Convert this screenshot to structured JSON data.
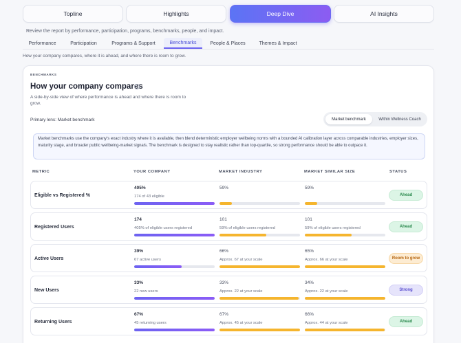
{
  "top_tabs": [
    "Topline",
    "Highlights",
    "Deep Dive",
    "AI Insights"
  ],
  "top_tabs_active": "Deep Dive",
  "review_text": "Review the report by performance, participation, programs, benchmarks, people, and impact.",
  "sub_tabs": [
    "Performance",
    "Participation",
    "Programs & Support",
    "Benchmarks",
    "People & Places",
    "Themes & Impact"
  ],
  "sub_tabs_active": "Benchmarks",
  "section_description": "How your company compares, where it is ahead, and where there is room to grow.",
  "card": {
    "eyebrow": "BENCHMARKS",
    "title": "How your company compares",
    "info_glyph": "i",
    "subtitle": "A side-by-side view of where performance is ahead and where there is room to grow.",
    "lens_label": "Primary lens: Market benchmark",
    "toggle": {
      "options": [
        "Market benchmark",
        "Within Wellness Coach"
      ],
      "active": "Market benchmark"
    },
    "note": "Market benchmarks use the company's exact industry where it is available, then blend deterministic employer wellbeing norms with a bounded AI calibration layer across comparable industries, employer sizes, maturity stage, and broader public wellbeing-market signals. The benchmark is designed to stay realistic rather than top-quartile, so strong performance should be able to outpace it.",
    "columns": [
      "METRIC",
      "YOUR COMPANY",
      "MARKET INDUSTRY",
      "MARKET SIMILAR SIZE",
      "STATUS"
    ],
    "rows": [
      {
        "metric": "Eligible vs Registered %",
        "company": {
          "value": "405%",
          "sub": "174 of 43 eligible",
          "fill": 1.0
        },
        "industry": {
          "value": "59%",
          "sub": "",
          "fill": 0.15
        },
        "similar": {
          "value": "59%",
          "sub": "",
          "fill": 0.15
        },
        "status": "Ahead",
        "status_kind": "ahead"
      },
      {
        "metric": "Registered Users",
        "company": {
          "value": "174",
          "sub": "405% of eligible users registered",
          "fill": 1.0
        },
        "industry": {
          "value": "101",
          "sub": "59% of eligible users registered",
          "fill": 0.58
        },
        "similar": {
          "value": "101",
          "sub": "59% of eligible users registered",
          "fill": 0.58
        },
        "status": "Ahead",
        "status_kind": "ahead"
      },
      {
        "metric": "Active Users",
        "company": {
          "value": "39%",
          "sub": "67 active users",
          "fill": 0.59
        },
        "industry": {
          "value": "66%",
          "sub": "Approx. 67 at your scale",
          "fill": 1.0
        },
        "similar": {
          "value": "65%",
          "sub": "Approx. 66 at your scale",
          "fill": 1.0
        },
        "status": "Room to grow",
        "status_kind": "grow"
      },
      {
        "metric": "New Users",
        "company": {
          "value": "33%",
          "sub": "22 new users",
          "fill": 1.0
        },
        "industry": {
          "value": "33%",
          "sub": "Approx. 22 at your scale",
          "fill": 0.98
        },
        "similar": {
          "value": "34%",
          "sub": "Approx. 22 at your scale",
          "fill": 1.0
        },
        "status": "Strong",
        "status_kind": "strong"
      },
      {
        "metric": "Returning Users",
        "company": {
          "value": "67%",
          "sub": "45 returning users",
          "fill": 1.0
        },
        "industry": {
          "value": "67%",
          "sub": "Approx. 45 at your scale",
          "fill": 1.0
        },
        "similar": {
          "value": "66%",
          "sub": "Approx. 44 at your scale",
          "fill": 0.99
        },
        "status": "Ahead",
        "status_kind": "ahead"
      }
    ]
  },
  "colors": {
    "accent_start": "#5b74f4",
    "accent_end": "#8c5cf2",
    "company_bar": "#7060f2",
    "market_bar": "#f5b52e",
    "ahead": "#2b8a4e",
    "room_to_grow": "#b5650f",
    "strong": "#5a4fd0"
  }
}
